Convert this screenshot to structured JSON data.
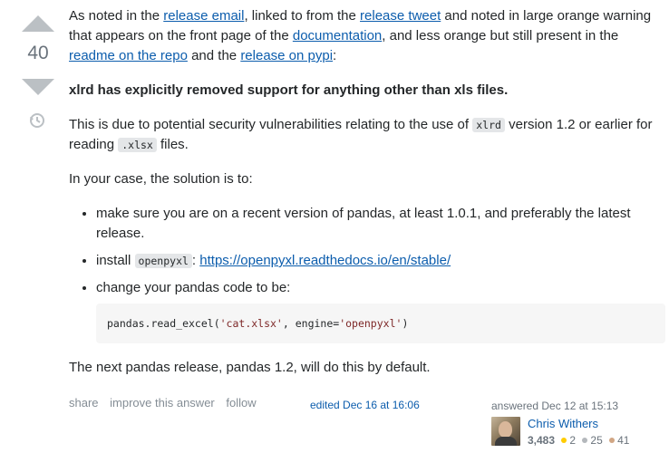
{
  "vote": {
    "count": "40"
  },
  "post": {
    "p1": {
      "t1": "As noted in the ",
      "link1": "release email",
      "t2": ", linked to from the ",
      "link2": "release tweet",
      "t3": " and noted in large orange warning that appears on the front page of the ",
      "link3": "documentation",
      "t4": ", and less orange but still present in the ",
      "link4": "readme on the repo",
      "t5": " and the ",
      "link5": "release on pypi",
      "t6": ":"
    },
    "p2_bold": "xlrd has explicitly removed support for anything other than xls files.",
    "p3": {
      "t1": "This is due to potential security vulnerabilities relating to the use of ",
      "code1": "xlrd",
      "t2": " version 1.2 or earlier for reading ",
      "code2": ".xlsx",
      "t3": " files."
    },
    "p4": "In your case, the solution is to:",
    "list": {
      "item1": "make sure you are on a recent version of pandas, at least 1.0.1, and preferably the latest release.",
      "item2_t1": "install ",
      "item2_code": "openpyxl",
      "item2_t2": ": ",
      "item2_link": "https://openpyxl.readthedocs.io/en/stable/",
      "item3": "change your pandas code to be:"
    },
    "code": {
      "c1": "pandas.read_excel(",
      "s1": "'cat.xlsx'",
      "c2": ", engine=",
      "s2": "'openpyxl'",
      "c3": ")"
    },
    "p5": "The next pandas release, pandas 1.2, will do this by default."
  },
  "footer": {
    "share": "share",
    "improve": "improve this answer",
    "follow": "follow",
    "edited": "edited Dec 16 at 16:06",
    "answered": "answered Dec 12 at 15:13",
    "user": {
      "name": "Chris Withers",
      "rep": "3,483",
      "gold": "2",
      "silver": "25",
      "bronze": "41"
    }
  },
  "colors": {
    "link": "#0c5dad",
    "vote_arrow": "#bbc0c4",
    "gold": "#ffcc01",
    "silver": "#b4b8bc",
    "bronze": "#d1a684"
  }
}
